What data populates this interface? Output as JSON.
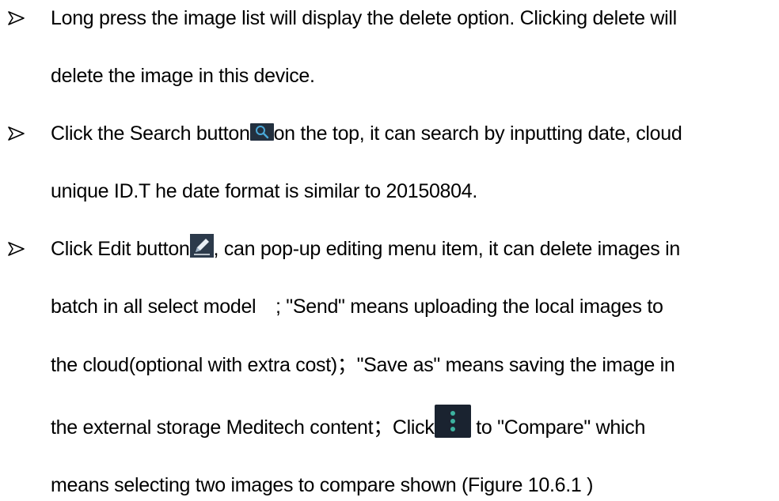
{
  "bullets": [
    {
      "lines": [
        {
          "text": "Long press the image list will display the delete option. Clicking delete will"
        },
        {
          "text": "delete the image in this device."
        }
      ]
    },
    {
      "lines": [
        {
          "before": "Click the Search button",
          "icon": "search-icon",
          "after": "on the top, it can search by inputting date, cloud"
        },
        {
          "text": "unique ID.T he date format is similar to 20150804."
        }
      ]
    },
    {
      "lines": [
        {
          "before": "Click Edit button",
          "icon": "edit-pencil-icon",
          "after": ", can pop-up editing menu item, it can delete images in"
        },
        {
          "text": "batch in all select model　; \"Send\" means uploading the local images to"
        },
        {
          "text": "the cloud(optional with extra cost)；\"Save as\" means saving the image in"
        },
        {
          "before": "the external storage Meditech content；Click",
          "icon": "more-vertical-icon",
          "after": " to \"Compare\" which"
        },
        {
          "text": "means selecting two images to compare shown (Figure 10.6.1 )"
        }
      ]
    }
  ],
  "colors": {
    "text": "#000000",
    "icon_dark": "#1a2330",
    "icon_glyph": "#4aa8d8"
  }
}
